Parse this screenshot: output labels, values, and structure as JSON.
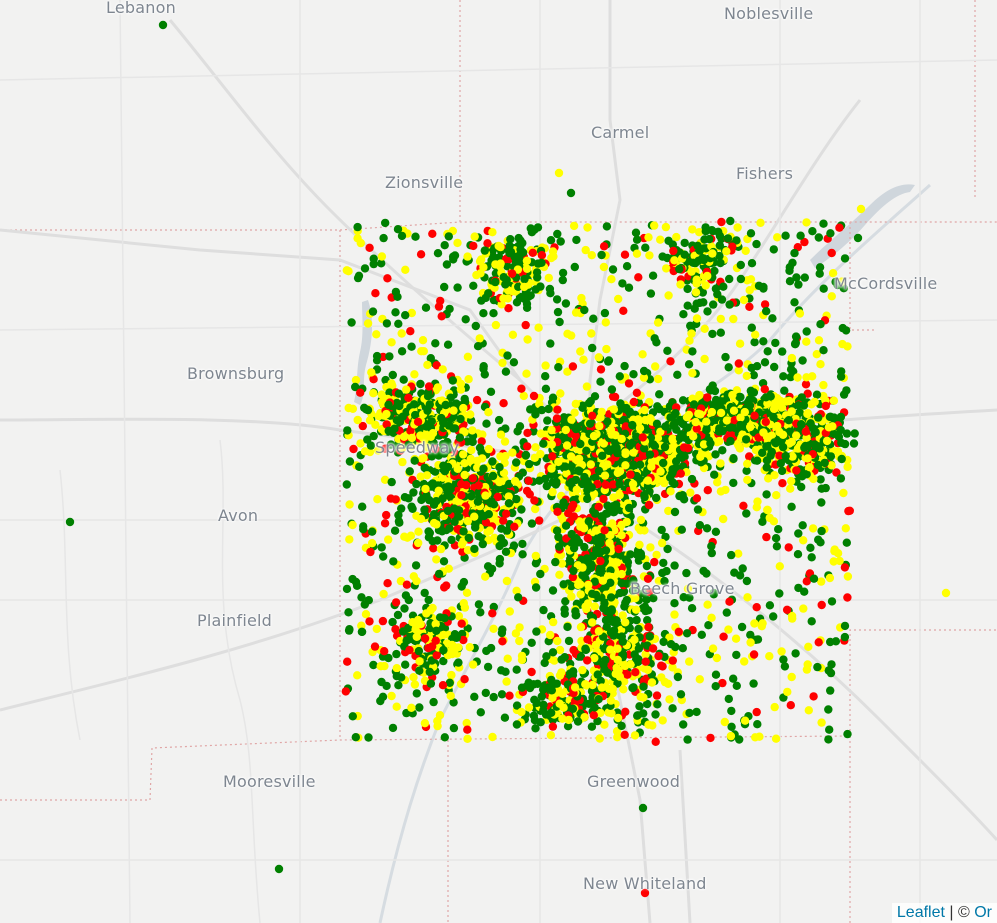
{
  "map": {
    "city_labels": [
      {
        "id": "lebanon",
        "text": "Lebanon"
      },
      {
        "id": "noblesville",
        "text": "Noblesville"
      },
      {
        "id": "carmel",
        "text": "Carmel"
      },
      {
        "id": "zionsville",
        "text": "Zionsville"
      },
      {
        "id": "fishers",
        "text": "Fishers"
      },
      {
        "id": "mccordsville",
        "text": "McCordsville"
      },
      {
        "id": "brownsburg",
        "text": "Brownsburg"
      },
      {
        "id": "speedway",
        "text": "Speedway"
      },
      {
        "id": "avon",
        "text": "Avon"
      },
      {
        "id": "plainfield",
        "text": "Plainfield"
      },
      {
        "id": "beech-grove",
        "text": "Beech Grove"
      },
      {
        "id": "mooresville",
        "text": "Mooresville"
      },
      {
        "id": "greenwood",
        "text": "Greenwood"
      },
      {
        "id": "new-whiteland",
        "text": "New Whiteland"
      }
    ],
    "marker_colors": {
      "green": "#008000",
      "yellow": "#ffff00",
      "red": "#ff0000"
    },
    "basemap_colors": {
      "land": "#f2f2f1",
      "roads": "#dcdcdc",
      "water": "#cfd6dc",
      "county_line": "#e0a6a6",
      "label": "#7e8690"
    }
  },
  "attribution": {
    "leaflet_link": "Leaflet",
    "separator": " | © ",
    "osm_link": "Or"
  }
}
